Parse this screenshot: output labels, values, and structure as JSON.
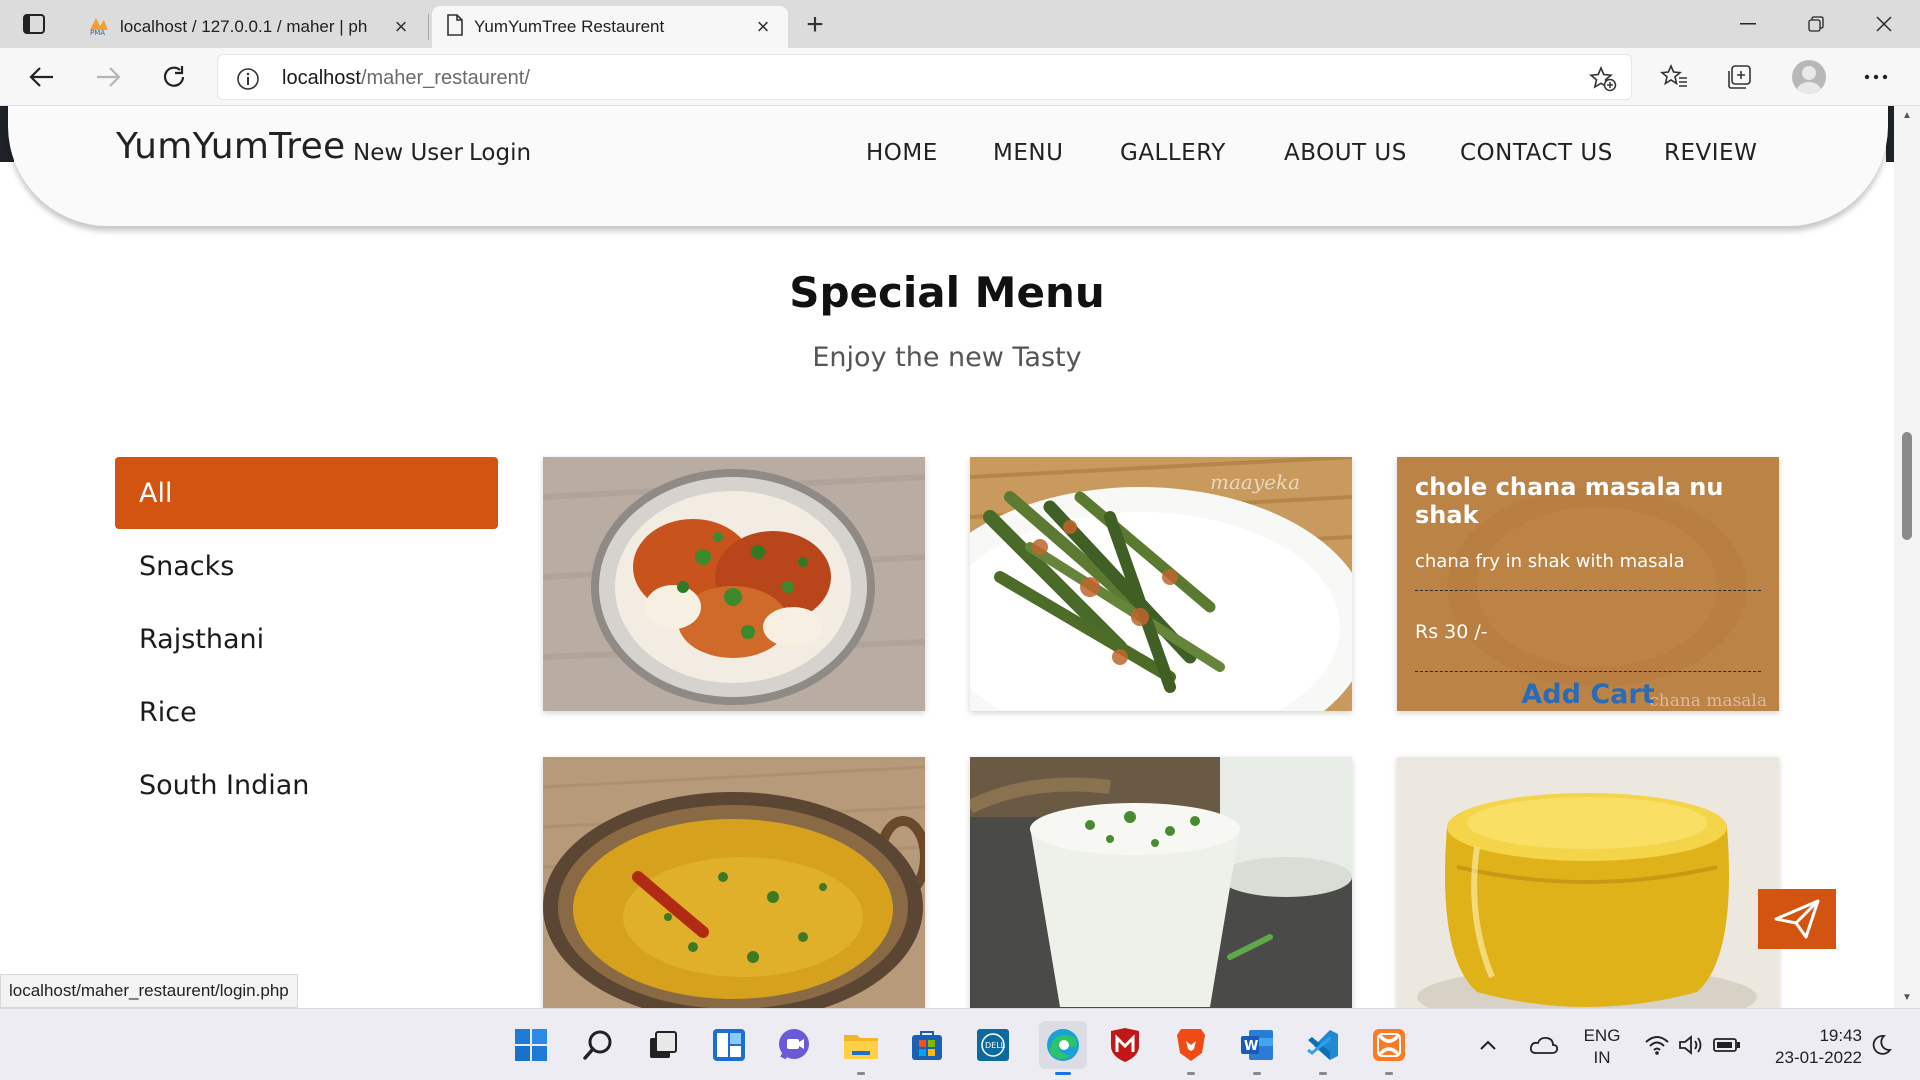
{
  "browser": {
    "tabs": [
      {
        "title": "localhost / 127.0.0.1 / maher | ph",
        "icon": "phpmyadmin-icon",
        "active": false
      },
      {
        "title": "YumYumTree Restaurent",
        "icon": "page-icon",
        "active": true
      }
    ],
    "address": {
      "host": "localhost",
      "path": "/maher_restaurent/"
    },
    "status_url": "localhost/maher_restaurent/login.php"
  },
  "site": {
    "brand": "YumYumTree",
    "account_links": [
      "New User",
      "Login"
    ],
    "nav": [
      "HOME",
      "MENU",
      "GALLERY",
      "ABOUT US",
      "CONTACT US",
      "REVIEW"
    ],
    "section": {
      "title": "Special Menu",
      "subtitle": "Enjoy the new Tasty"
    },
    "categories": [
      "All",
      "Snacks",
      "Rajsthani",
      "Rice",
      "South Indian"
    ],
    "active_category": "All",
    "hover_card": {
      "title": "chole chana masala nu shak",
      "description": "chana fry in shak with masala",
      "price": "Rs 30 /-",
      "button": "Add Cart",
      "ghost_text": "chana masala"
    },
    "photo_watermark": "maayeka",
    "accent_color": "#d35410"
  },
  "taskbar": {
    "apps": [
      "windows-start-icon",
      "search-icon",
      "task-view-icon",
      "widgets-icon",
      "chat-icon",
      "file-explorer-icon",
      "microsoft-store-icon",
      "dell-icon",
      "edge-icon",
      "mcafee-icon",
      "brave-icon",
      "word-icon",
      "vscode-icon",
      "xampp-icon"
    ],
    "language": {
      "line1": "ENG",
      "line2": "IN"
    },
    "time": "19:43",
    "date": "23-01-2022"
  }
}
